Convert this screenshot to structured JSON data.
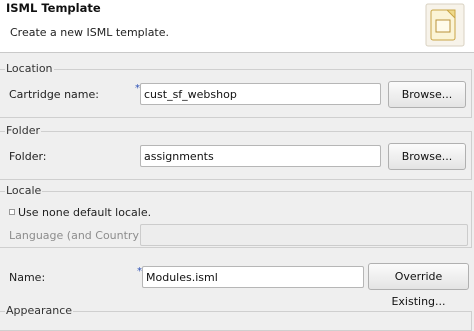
{
  "header": {
    "title": "ISML Template",
    "description": "Create a new ISML template.",
    "icon": "template-file-icon"
  },
  "location": {
    "group_title": "Location",
    "cartridge_label": "Cartridge name:",
    "cartridge_value": "cust_sf_webshop",
    "browse_label": "Browse..."
  },
  "folder": {
    "group_title": "Folder",
    "folder_label": "Folder:",
    "folder_value": "assignments",
    "browse_label": "Browse..."
  },
  "locale": {
    "group_title": "Locale",
    "checkbox_label": "Use none default locale.",
    "checkbox_checked": false,
    "language_label": "Language (and Country):",
    "language_value": ""
  },
  "name": {
    "label": "Name:",
    "value": "Modules.isml",
    "override_label": "Override Existing..."
  },
  "appearance": {
    "group_title": "Appearance"
  },
  "colors": {
    "background": "#efefef",
    "header_background": "#ffffff",
    "required_marker": "#2a4fb5"
  }
}
